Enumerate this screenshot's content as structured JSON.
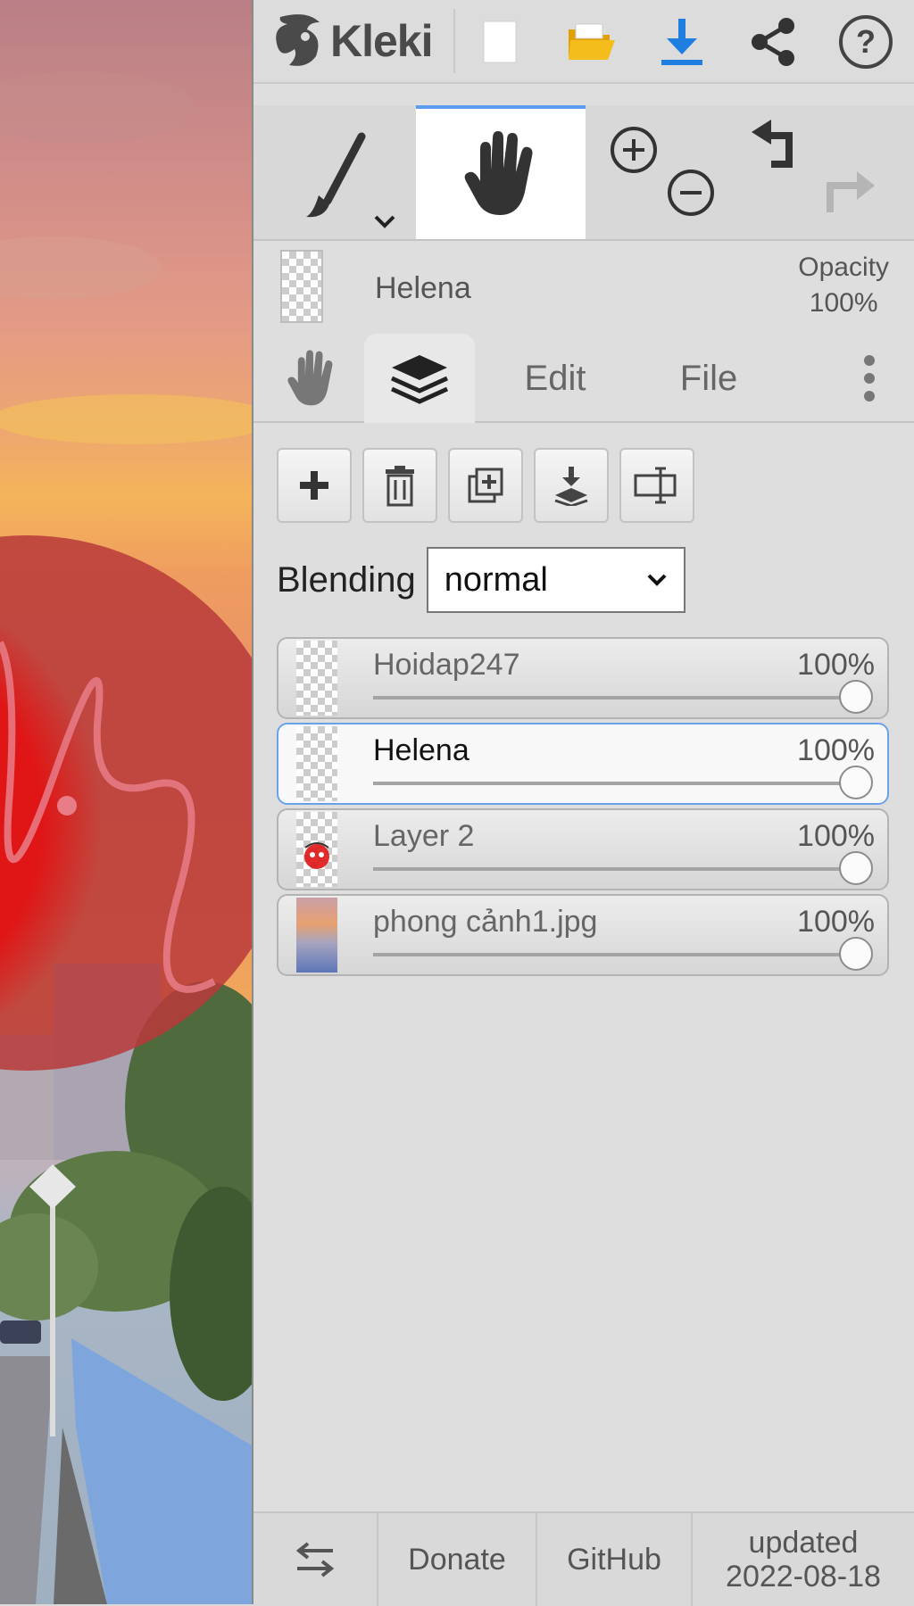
{
  "app": {
    "name": "Kleki"
  },
  "header": {
    "icons": [
      "new-image-icon",
      "open-folder-icon",
      "download-icon",
      "share-icon",
      "help-icon"
    ],
    "colors": {
      "folder": "#f0b400",
      "download": "#1e7fe0"
    }
  },
  "tools": {
    "items": [
      "brush-tool",
      "hand-tool",
      "zoom-in",
      "zoom-out",
      "undo",
      "redo"
    ],
    "active": "hand-tool",
    "accent_color": "#5b9bf0"
  },
  "current_layer": {
    "name": "Helena",
    "opacity_label": "Opacity",
    "opacity_value": "100%"
  },
  "tabs": {
    "items": [
      {
        "label": "",
        "icon": "hand-icon"
      },
      {
        "label": "",
        "icon": "layers-icon",
        "active": true
      },
      {
        "label": "Edit"
      },
      {
        "label": "File"
      },
      {
        "label": "",
        "icon": "more-vertical-icon"
      }
    ]
  },
  "layer_buttons": [
    "add-layer-icon",
    "delete-layer-icon",
    "duplicate-layer-icon",
    "merge-down-icon",
    "rename-layer-icon"
  ],
  "blending": {
    "label": "Blending",
    "value": "normal"
  },
  "layers": [
    {
      "name": "Hoidap247",
      "opacity": "100%",
      "opacity_fraction": 1.0,
      "selected": false
    },
    {
      "name": "Helena",
      "opacity": "100%",
      "opacity_fraction": 1.0,
      "selected": true
    },
    {
      "name": "Layer 2",
      "opacity": "100%",
      "opacity_fraction": 1.0,
      "selected": false
    },
    {
      "name": "phong cảnh1.jpg",
      "opacity": "100%",
      "opacity_fraction": 1.0,
      "selected": false
    }
  ],
  "footer": {
    "swap_icon": "swap-arrows-icon",
    "donate": "Donate",
    "github": "GitHub",
    "updated_label": "updated",
    "updated_date": "2022-08-18"
  }
}
